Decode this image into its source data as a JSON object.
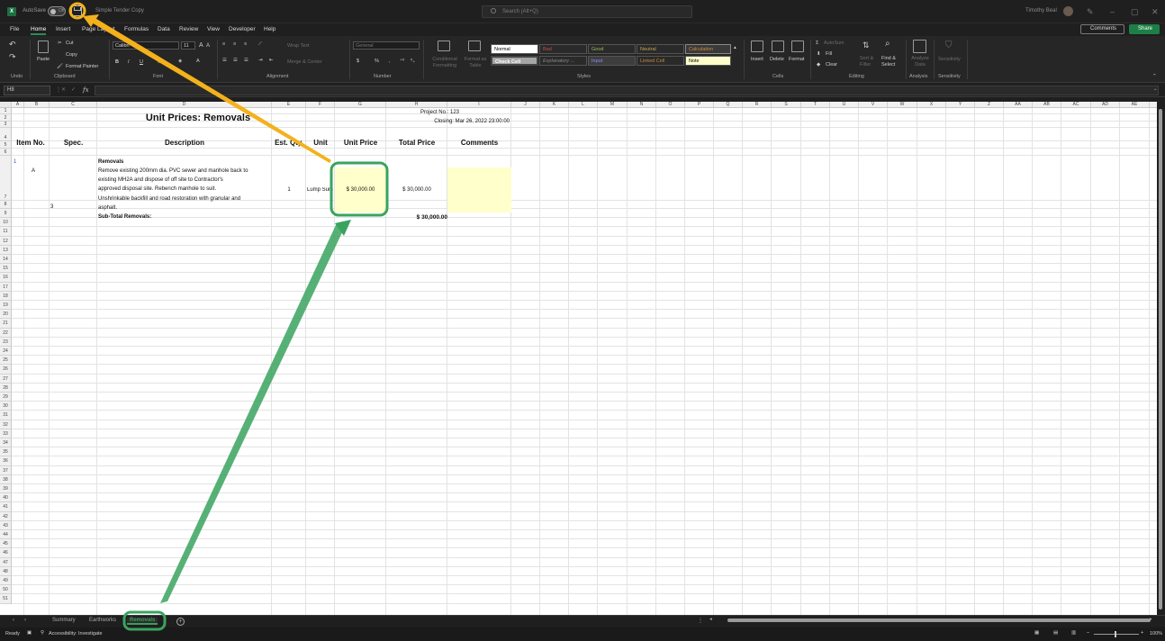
{
  "titlebar": {
    "app_icon": "excel-icon",
    "autosave_label": "AutoSave",
    "autosave_state": "Off",
    "document_title": "Simple Tender Copy",
    "search_placeholder": "Search (Alt+Q)",
    "user_name": "Timothy Beal"
  },
  "menu": {
    "tabs": [
      "File",
      "Home",
      "Insert",
      "Page Layout",
      "Formulas",
      "Data",
      "Review",
      "View",
      "Developer",
      "Help"
    ],
    "active": "Home",
    "comments_label": "Comments",
    "share_label": "Share"
  },
  "ribbon": {
    "undo": {
      "group": "Undo"
    },
    "clipboard": {
      "paste": "Paste",
      "cut": "Cut",
      "copy": "Copy",
      "format_painter": "Format Painter",
      "group": "Clipboard"
    },
    "font": {
      "font_name": "Calibri",
      "font_size": "11",
      "bold": "B",
      "italic": "I",
      "underline": "U",
      "group": "Font"
    },
    "alignment": {
      "wrap_text": "Wrap Text",
      "merge_center": "Merge & Center",
      "group": "Alignment"
    },
    "number": {
      "format": "General",
      "currency": "$",
      "percent": "%",
      "comma": ",",
      "group": "Number"
    },
    "styles": {
      "conditional_formatting": "Conditional Formatting",
      "format_as_table": "Format as Table",
      "items": [
        "Normal",
        "Bad",
        "Good",
        "Neutral",
        "Calculation",
        "Check Cell",
        "Explanatory ...",
        "Input",
        "Linked Cell",
        "Note"
      ],
      "group": "Styles"
    },
    "cells": {
      "insert": "Insert",
      "delete": "Delete",
      "format": "Format",
      "group": "Cells"
    },
    "editing": {
      "autosum": "AutoSum",
      "fill": "Fill",
      "clear": "Clear",
      "sort_filter": "Sort & Filter",
      "find_select": "Find & Select",
      "group": "Editing"
    },
    "analysis": {
      "analyze_data": "Analyze Data",
      "group": "Analysis"
    },
    "sensitivity": {
      "label": "Sensitivity",
      "group": "Sensitivity"
    }
  },
  "formula_bar": {
    "name_box": "H8",
    "fx": "fx",
    "value": ""
  },
  "sheet": {
    "columns": [
      "A",
      "B",
      "C",
      "D",
      "E",
      "F",
      "G",
      "H",
      "I",
      "J",
      "K",
      "L",
      "M",
      "N",
      "O",
      "P",
      "Q",
      "R",
      "S",
      "T",
      "U",
      "V",
      "W",
      "X",
      "Y",
      "Z",
      "AA",
      "AB",
      "AC",
      "AD",
      "AE",
      "AF"
    ],
    "rows": [
      "1",
      "2",
      "3",
      "4",
      "5",
      "6",
      "7",
      "8",
      "9",
      "10",
      "11",
      "12",
      "13",
      "14",
      "15",
      "16",
      "17",
      "18",
      "19",
      "20",
      "21",
      "22",
      "23",
      "24",
      "25",
      "26",
      "27",
      "28",
      "29",
      "30",
      "31",
      "32",
      "33",
      "34",
      "35",
      "36",
      "37",
      "38",
      "39",
      "40",
      "41",
      "42",
      "43",
      "44",
      "45",
      "46",
      "47",
      "48",
      "49",
      "50",
      "51"
    ],
    "title": "Unit Prices: Removals",
    "project_no": "Project No.: 123",
    "closing": "Closing: Mar 26, 2022 23:00:00",
    "headers": {
      "item_no": "Item No.",
      "spec": "Spec.",
      "description": "Description",
      "est_qty": "Est. Qty.",
      "unit": "Unit",
      "unit_price": "Unit Price",
      "total_price": "Total Price",
      "comments": "Comments"
    },
    "section_number": "1",
    "section_name": "Removals",
    "item": {
      "letter": "A",
      "spec": "3",
      "description_lines": [
        "Remove existing 200mm dia. PVC sewer and manhole back to",
        "existing MH2A and dispose of off site to Contractor's",
        "approved disposal site.  Rebench manhole to suit.",
        "Unshrinkable backfill and road restoration with granular and",
        "asphalt."
      ],
      "qty": "1",
      "unit": "Lump Sum",
      "unit_price": "$ 30,000.00",
      "total_price": "$ 30,000.00"
    },
    "subtotal_label": "Sub-Total Removals:",
    "subtotal_value": "$ 30,000.00"
  },
  "sheet_tabs": {
    "tabs": [
      "Summary",
      "Earthworks",
      "Removals"
    ],
    "active": "Removals",
    "add": "+"
  },
  "status": {
    "ready": "Ready",
    "accessibility": "Accessibility: Investigate",
    "zoom": "100%"
  },
  "annotations": {
    "highlight_color": "#3aa35f",
    "callout_color": "#f3b11c"
  }
}
